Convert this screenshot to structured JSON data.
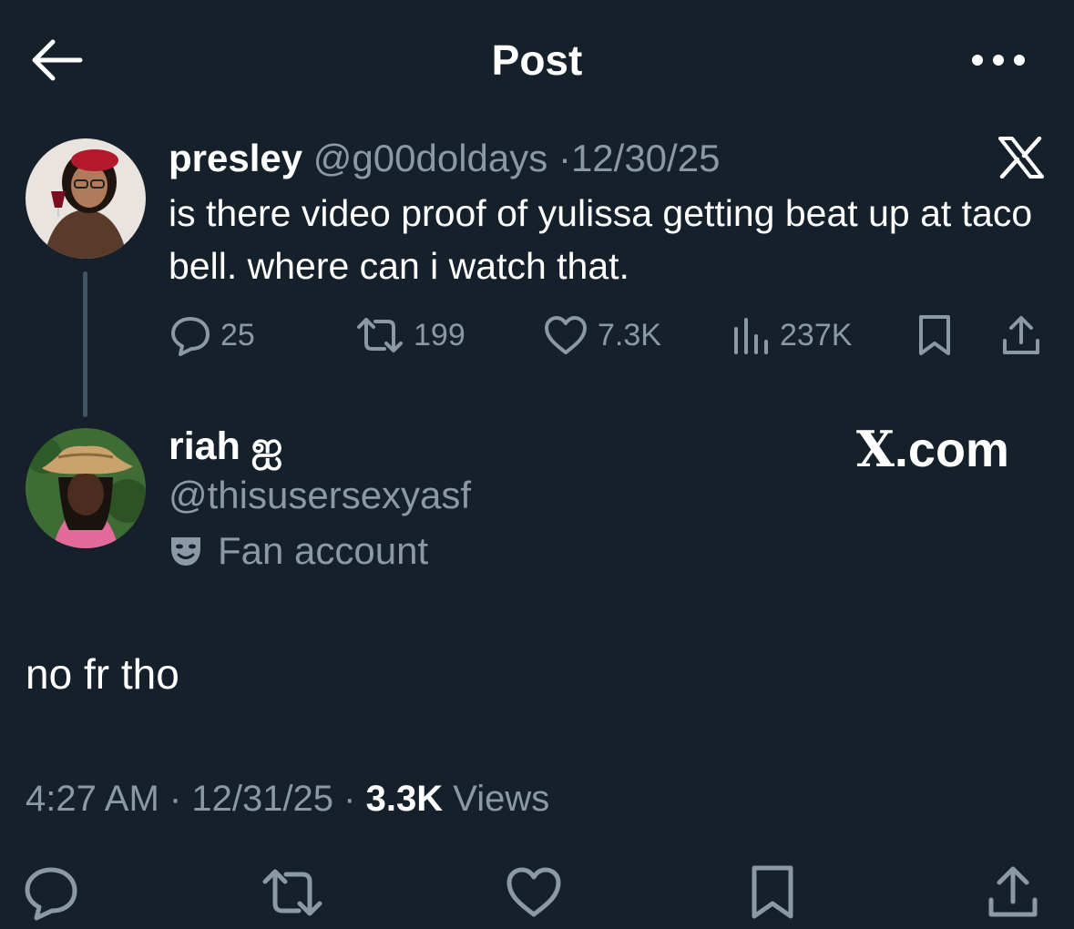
{
  "header": {
    "title": "Post"
  },
  "quoted_post": {
    "display_name": "presley",
    "handle": "@g00doldays",
    "separator": "·",
    "date": "12/30/25",
    "body": "is there video proof of yulissa getting beat up at taco bell. where can i watch that.",
    "stats": {
      "replies": "25",
      "reposts": "199",
      "likes": "7.3K",
      "views": "237K"
    }
  },
  "reply": {
    "display_name": "riah ஐ",
    "handle": "@thisusersexyasf",
    "label": "Fan account",
    "body": "no fr tho",
    "time": "4:27 AM",
    "separator": "·",
    "date": "12/31/25",
    "views_count": "3.3K",
    "views_label": "Views"
  },
  "watermark": {
    "x_glyph": "X",
    "text": ".com"
  },
  "colors": {
    "background": "#15202b",
    "text": "#ffffff",
    "muted": "#8b98a5",
    "thread_line": "#425364"
  },
  "icons": [
    "back-arrow-icon",
    "more-icon",
    "x-logo-icon",
    "reply-icon",
    "repost-icon",
    "like-icon",
    "views-icon",
    "bookmark-icon",
    "share-icon",
    "theater-masks-icon"
  ]
}
